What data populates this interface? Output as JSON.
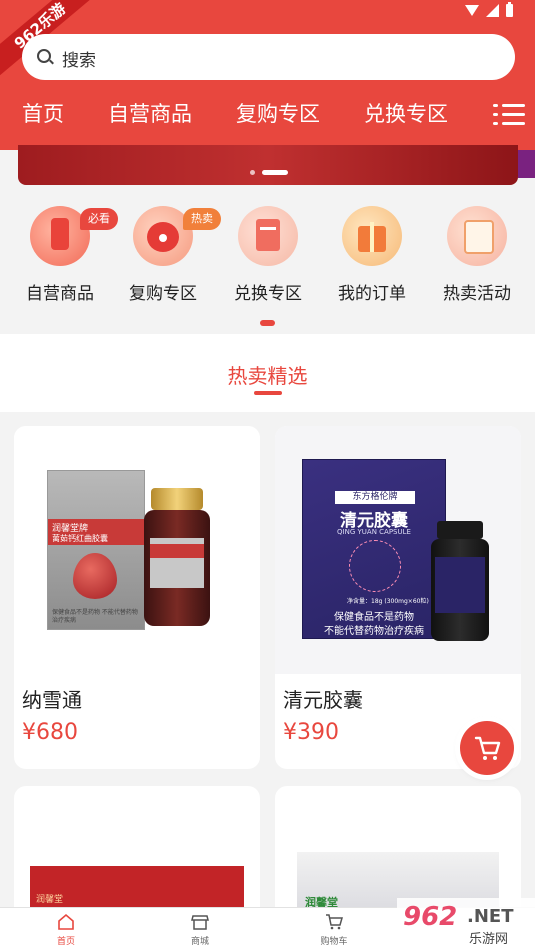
{
  "corner_badge": "962乐游",
  "search": {
    "placeholder": "搜索"
  },
  "nav_tabs": [
    "首页",
    "自营商品",
    "复购专区",
    "兑换专区"
  ],
  "quick_menu": [
    {
      "label": "自营商品",
      "badge": "必看"
    },
    {
      "label": "复购专区",
      "badge": "热卖"
    },
    {
      "label": "兑换专区"
    },
    {
      "label": "我的订单"
    },
    {
      "label": "热卖活动"
    }
  ],
  "section": {
    "title": "热卖精选"
  },
  "products": [
    {
      "name": "纳雪通",
      "price": "¥680",
      "pack_brand": "润馨堂牌",
      "pack_line1": "蓠茹钙红曲胶囊",
      "pack_note": "保健食品不是药物 不能代替药物治疗疾病"
    },
    {
      "name": "清元胶囊",
      "price": "¥390",
      "pack_brand": "东方格伦牌",
      "pack_title": "清元胶囊",
      "pack_sub": "QING YUAN CAPSULE",
      "pack_spec": "净含量：18g (300mg×60粒)",
      "pack_note1": "保健食品不是药物",
      "pack_note2": "不能代替药物治疗疾病"
    },
    {
      "pack_brand": "润馨堂"
    },
    {
      "pack_brand": "润馨堂"
    }
  ],
  "bottom_nav": [
    "首页",
    "商城",
    "购物车"
  ],
  "watermark": {
    "logo": "962",
    "net": ".NET",
    "sub": "乐游网"
  },
  "colors": {
    "primary": "#e8473e",
    "badge_bg": "#f1803b"
  }
}
